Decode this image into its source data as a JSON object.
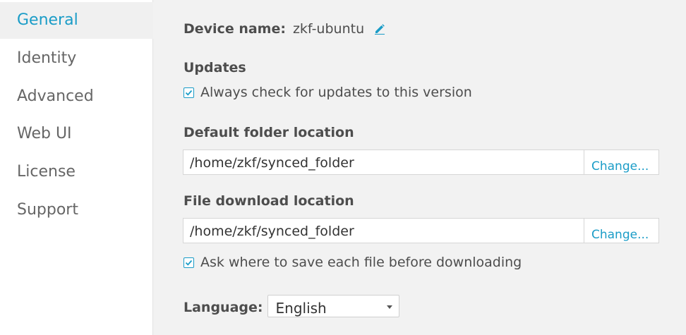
{
  "sidebar": {
    "items": [
      {
        "label": "General",
        "active": true
      },
      {
        "label": "Identity",
        "active": false
      },
      {
        "label": "Advanced",
        "active": false
      },
      {
        "label": "Web UI",
        "active": false
      },
      {
        "label": "License",
        "active": false
      },
      {
        "label": "Support",
        "active": false
      }
    ]
  },
  "device": {
    "label": "Device name:",
    "value": "zkf-ubuntu",
    "edit_icon": "pencil-icon"
  },
  "updates": {
    "title": "Updates",
    "check_label": "Always check for updates to this version",
    "checked": true
  },
  "default_folder": {
    "title": "Default folder location",
    "path": "/home/zkf/synced_folder",
    "change_label": "Change..."
  },
  "download_folder": {
    "title": "File download location",
    "path": "/home/zkf/synced_folder",
    "change_label": "Change...",
    "ask_label": "Ask where to save each file before downloading",
    "ask_checked": true
  },
  "language": {
    "label": "Language:",
    "selected": "English"
  },
  "colors": {
    "accent": "#1a9cc7",
    "sidebar_bg": "#ffffff",
    "main_bg": "#f2f2f2",
    "active_item_bg": "#f0f0f0"
  }
}
